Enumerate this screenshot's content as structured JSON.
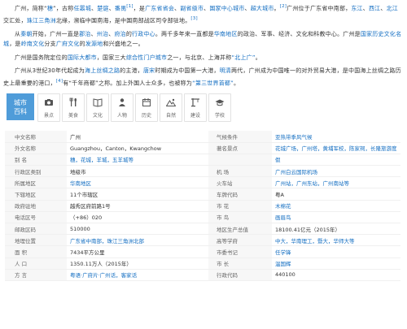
{
  "paragraphs": [
    [
      {
        "t": "广州，简称“"
      },
      {
        "t": "穗",
        "link": true
      },
      {
        "t": "”，古称"
      },
      {
        "t": "任嚣城",
        "link": true
      },
      {
        "t": "、"
      },
      {
        "t": "楚庭",
        "link": true
      },
      {
        "t": "、"
      },
      {
        "t": "番禺",
        "link": true
      },
      {
        "t": "[1]",
        "sup": true
      },
      {
        "t": "，是"
      },
      {
        "t": "广东省省会",
        "link": true
      },
      {
        "t": "、"
      },
      {
        "t": "副省级市",
        "link": true
      },
      {
        "t": "、"
      },
      {
        "t": "国家中心城市",
        "link": true
      },
      {
        "t": "、"
      },
      {
        "t": "超大城市",
        "link": true
      },
      {
        "t": "。"
      },
      {
        "t": "[2]",
        "sup": true
      },
      {
        "t": "广州位于广东省中南部，"
      },
      {
        "t": "东江",
        "link": true
      },
      {
        "t": "、"
      },
      {
        "t": "西江",
        "link": true
      },
      {
        "t": "、"
      },
      {
        "t": "北江",
        "link": true
      },
      {
        "t": "交汇处，"
      },
      {
        "t": "珠江三角洲",
        "link": true
      },
      {
        "t": "北缘，濒临中国南海，是中国南部战区司令部驻地。"
      },
      {
        "t": "[3]",
        "sup": true
      }
    ],
    [
      {
        "t": "从"
      },
      {
        "t": "秦朝",
        "link": true
      },
      {
        "t": "开始，广州一直是"
      },
      {
        "t": "郡治",
        "link": true
      },
      {
        "t": "、"
      },
      {
        "t": "州治",
        "link": true
      },
      {
        "t": "、"
      },
      {
        "t": "府治",
        "link": true
      },
      {
        "t": "的"
      },
      {
        "t": "行政中心",
        "link": true
      },
      {
        "t": "。两千多年来一直都是"
      },
      {
        "t": "华南地区",
        "link": true
      },
      {
        "t": "的政治、军事、经济、文化和科教中心。广州是"
      },
      {
        "t": "国家历史文化名城",
        "link": true
      },
      {
        "t": "，是"
      },
      {
        "t": "岭南文化",
        "link": true
      },
      {
        "t": "分支"
      },
      {
        "t": "广府文化",
        "link": true
      },
      {
        "t": "的"
      },
      {
        "t": "发源地",
        "link": true
      },
      {
        "t": "和兴盛地之一。"
      }
    ],
    [
      {
        "t": "广州是国务院定位的"
      },
      {
        "t": "国际大都市",
        "link": true
      },
      {
        "t": "，国家三大"
      },
      {
        "t": "综合性门户城市",
        "link": true
      },
      {
        "t": "之一，与北京、上海并称"
      },
      {
        "t": "“北上广”",
        "link": true
      },
      {
        "t": "。"
      }
    ],
    [
      {
        "t": "广州从3世纪30年代起成为"
      },
      {
        "t": "海上丝绸之路",
        "link": true
      },
      {
        "t": "的主港，"
      },
      {
        "t": "唐宋",
        "link": true
      },
      {
        "t": "时期成为中国第一大港，"
      },
      {
        "t": "明清",
        "link": true
      },
      {
        "t": "两代，广州成为中国唯一的对外贸易大港，是中国海上丝绸之路历史上最重要的港口，"
      },
      {
        "t": "[4]",
        "sup": true
      },
      {
        "t": "有“千年商都”之称。加上外国人士众多，也被称为"
      },
      {
        "t": "“第三世界首都”",
        "link": true
      },
      {
        "t": "。"
      }
    ]
  ],
  "category_bar": {
    "badge_line1": "城市",
    "badge_line2": "百科",
    "items": [
      {
        "label": "景点",
        "icon": "camera-icon"
      },
      {
        "label": "美食",
        "icon": "cutlery-icon"
      },
      {
        "label": "文化",
        "icon": "book-icon"
      },
      {
        "label": "人物",
        "icon": "person-icon"
      },
      {
        "label": "历史",
        "icon": "calendar-icon"
      },
      {
        "label": "自然",
        "icon": "mountain-icon"
      },
      {
        "label": "建设",
        "icon": "crane-icon"
      },
      {
        "label": "学校",
        "icon": "graduation-cap-icon"
      }
    ]
  },
  "info_rows": [
    {
      "k1": "中文名称",
      "v1": "广州",
      "l1": false,
      "k2": "气候条件",
      "v2": "亚热带季风气候",
      "l2": true
    },
    {
      "k1": "外文名称",
      "v1": "Guangzhou，Canton，Kwangchow",
      "l1": false,
      "k2": "著名景点",
      "v2": "花城广场，广州塔，黄埔军校，陈家祠，长隆旅游度",
      "l2": true
    },
    {
      "k1": "别    名",
      "v1": "穗，花城，羊城，五羊城等",
      "l1": true,
      "k2": "",
      "v2": "假",
      "l2": true
    },
    {
      "k1": "行政区类别",
      "v1": "地级市",
      "l1": false,
      "k2": "机    场",
      "v2": "广州白云国际机场",
      "l2": true
    },
    {
      "k1": "所属地区",
      "v1": "华南地区",
      "l1": true,
      "k2": "火车站",
      "v2": "广州站，广州东站，广州南站等",
      "l2": true
    },
    {
      "k1": "下辖地区",
      "v1": "11个市辖区",
      "l1": false,
      "k2": "车牌代码",
      "v2": "粤A",
      "l2": false
    },
    {
      "k1": "政府驻地",
      "v1": "越秀区府前路1号",
      "l1": false,
      "k2": "市    花",
      "v2": "木棉花",
      "l2": true
    },
    {
      "k1": "电话区号",
      "v1": "（+86）020",
      "l1": false,
      "k2": "市    鸟",
      "v2": "画眉鸟",
      "l2": true
    },
    {
      "k1": "邮政区码",
      "v1": "510000",
      "l1": false,
      "k2": "地区生产总值",
      "v2": "18100.41亿元（2015年）",
      "l2": false
    },
    {
      "k1": "地理位置",
      "v1": "广东省中南部，珠江三角洲北部",
      "l1": true,
      "k2": "高等学府",
      "v2": "中大，华南理工，暨大，华师大等",
      "l2": true
    },
    {
      "k1": "面    积",
      "v1": "7434平方公里",
      "l1": false,
      "k2": "市委书记",
      "v2": "任学锋",
      "l2": true
    },
    {
      "k1": "人    口",
      "v1": "1350.11万人（2015年）",
      "l1": false,
      "k2": "市    长",
      "v2": "温国辉",
      "l2": true
    },
    {
      "k1": "方    言",
      "v1": "粤语·广府片·广州话，客家话",
      "l1": true,
      "k2": "行政代码",
      "v2": "440100",
      "l2": false
    }
  ],
  "extra_row2_aside": "别名旁",
  "colors": {
    "link": "#136ec2",
    "badge": "#4f9cd9",
    "label_bg": "#f7f7f7"
  }
}
